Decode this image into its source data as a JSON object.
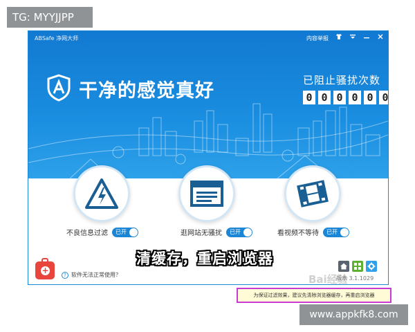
{
  "overlay": {
    "tg_label": "TG: MYYJJPP",
    "site_label": "www.appkfk8.com",
    "baidu_watermark": "Bai经验"
  },
  "window": {
    "app_name": "ABSafe 净网大师",
    "content_report": "内容举报",
    "controls": [
      "shirt-icon",
      "menu-icon",
      "minimize-icon",
      "close-icon"
    ]
  },
  "hero": {
    "slogan": "干净的感觉真好",
    "block_count_title": "已阻止骚扰次数",
    "block_digits": [
      "0",
      "0",
      "0",
      "0",
      "0",
      "0"
    ]
  },
  "features": [
    {
      "icon": "warning-lightning-icon",
      "label": "不良信息过滤",
      "toggle": "已开"
    },
    {
      "icon": "webpage-icon",
      "label": "逛网站无骚扰",
      "toggle": "已开"
    },
    {
      "icon": "film-icon",
      "label": "看视频不等待",
      "toggle": "已开"
    }
  ],
  "caption": "清缓存，重启浏览器",
  "footer": {
    "help_text": "软件无法正常使用？",
    "version": "版本 3.1.1029"
  },
  "notice": "为保证过滤效果，建议先清除浏览器缓存，再重启浏览器",
  "colors": {
    "brand_blue": "#1c86d6",
    "toggle_blue": "#1c86d6",
    "notice_border": "#c93ad2",
    "toolkit_red": "#e8453c"
  }
}
